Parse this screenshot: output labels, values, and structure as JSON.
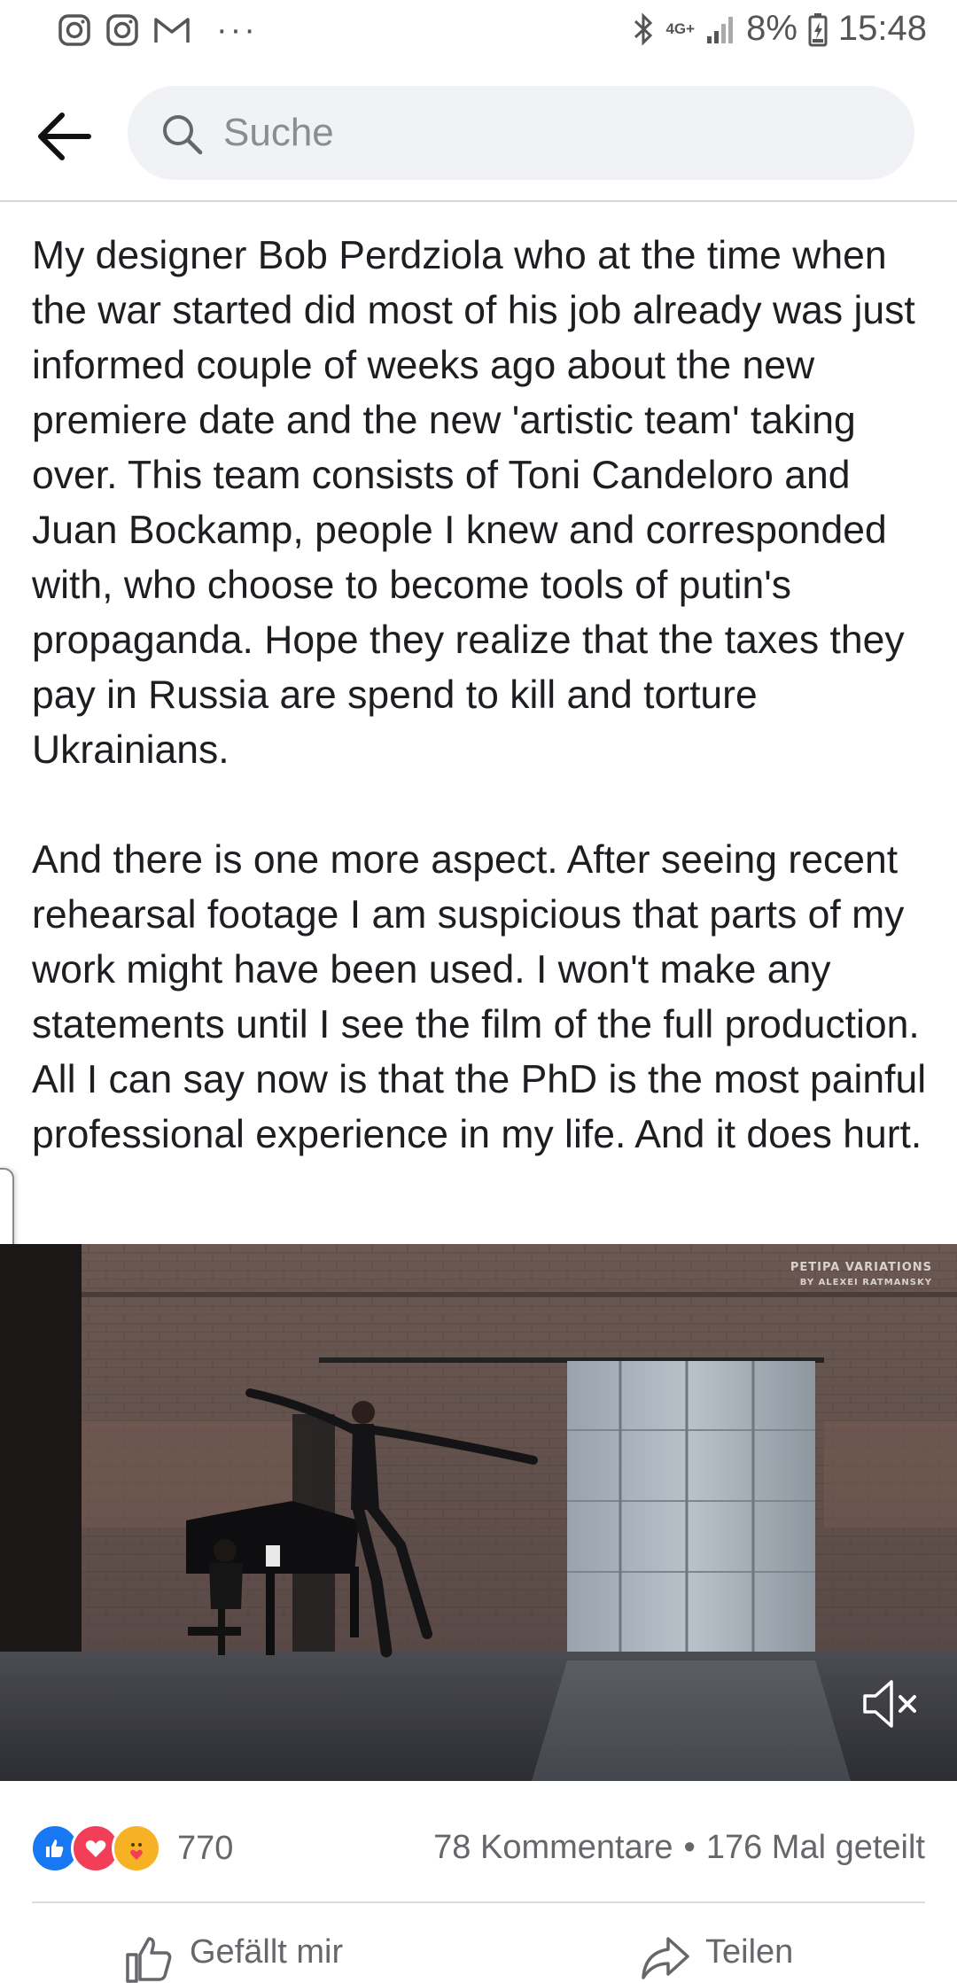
{
  "status_bar": {
    "network": "4G+",
    "battery_percent": "8%",
    "time": "15:48",
    "left_icons": [
      "instagram-icon",
      "instagram-icon",
      "gmail-icon",
      "more-dots-icon"
    ],
    "right_icons": [
      "bluetooth-icon",
      "signal-icon",
      "battery-icon"
    ]
  },
  "search": {
    "placeholder": "Suche",
    "value": ""
  },
  "post": {
    "paragraphs": [
      "My designer Bob Perdziola who at the time when the war started did most of his job already was just informed couple of weeks ago about the new premiere date and the new 'artistic team' taking over. This team consists of Toni Candeloro and Juan Bockamp, people I knew and corresponded with, who choose to become tools of putin's propaganda. Hope they realize that the taxes they pay in Russia are spend to kill and torture Ukrainians.",
      "And there is one more aspect. After seeing recent rehearsal footage I am suspicious that parts of my work might have been used. I won't make any statements until I see the film of the full production. All I can say now is that the PhD is the most painful professional experience in my life. And it does hurt."
    ]
  },
  "video": {
    "watermark_line1": "PETIPA VARIATIONS",
    "watermark_line2": "BY ALEXEI RATMANSKY",
    "muted": true
  },
  "engagement": {
    "reactions": [
      "like",
      "love",
      "care"
    ],
    "reaction_count": "770",
    "comments": "78 Kommentare",
    "separator": "•",
    "shares": "176 Mal geteilt"
  },
  "actions": {
    "like_label": "Gefällt mir",
    "share_label": "Teilen"
  },
  "colors": {
    "like_blue": "#1877f2",
    "love_red": "#f33e58",
    "care_yellow": "#f7b125",
    "secondary_text": "#65676b"
  }
}
